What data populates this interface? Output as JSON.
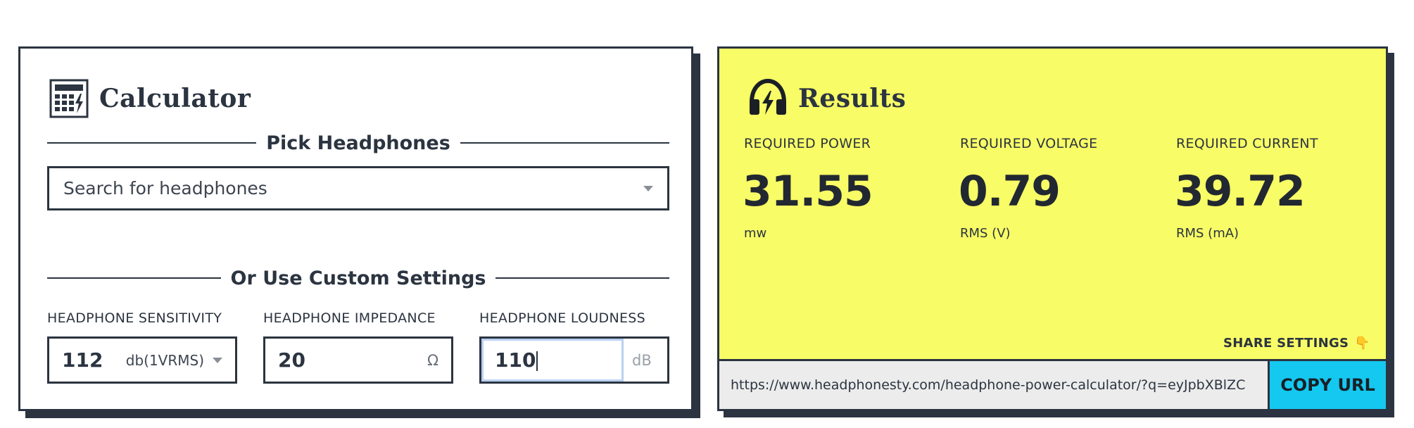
{
  "calculator": {
    "title": "Calculator",
    "icon": "calculator-icon",
    "pick_heading": "Pick Headphones",
    "search_placeholder": "Search for headphones",
    "custom_heading": "Or Use Custom Settings",
    "fields": {
      "sensitivity": {
        "label": "HEADPHONE SENSITIVITY",
        "value": "112",
        "unit": "db(1VRMS)"
      },
      "impedance": {
        "label": "HEADPHONE IMPEDANCE",
        "value": "20",
        "unit": "Ω"
      },
      "loudness": {
        "label": "HEADPHONE LOUDNESS",
        "value": "110",
        "unit": "dB"
      }
    }
  },
  "results": {
    "title": "Results",
    "icon": "headphones-bolt-icon",
    "background": "#f8fc66",
    "power": {
      "label": "REQUIRED POWER",
      "value": "31.55",
      "unit": "mw"
    },
    "voltage": {
      "label": "REQUIRED VOLTAGE",
      "value": "0.79",
      "unit": "RMS (V)"
    },
    "current": {
      "label": "REQUIRED CURRENT",
      "value": "39.72",
      "unit": "RMS (mA)"
    },
    "share_label": "SHARE SETTINGS",
    "share_icon": "pointing-down-hand-icon",
    "url": "https://www.headphonesty.com/headphone-power-calculator/?q=eyJpbXBlZC",
    "copy_label": "COPY URL",
    "copy_color": "#14c8f0"
  }
}
